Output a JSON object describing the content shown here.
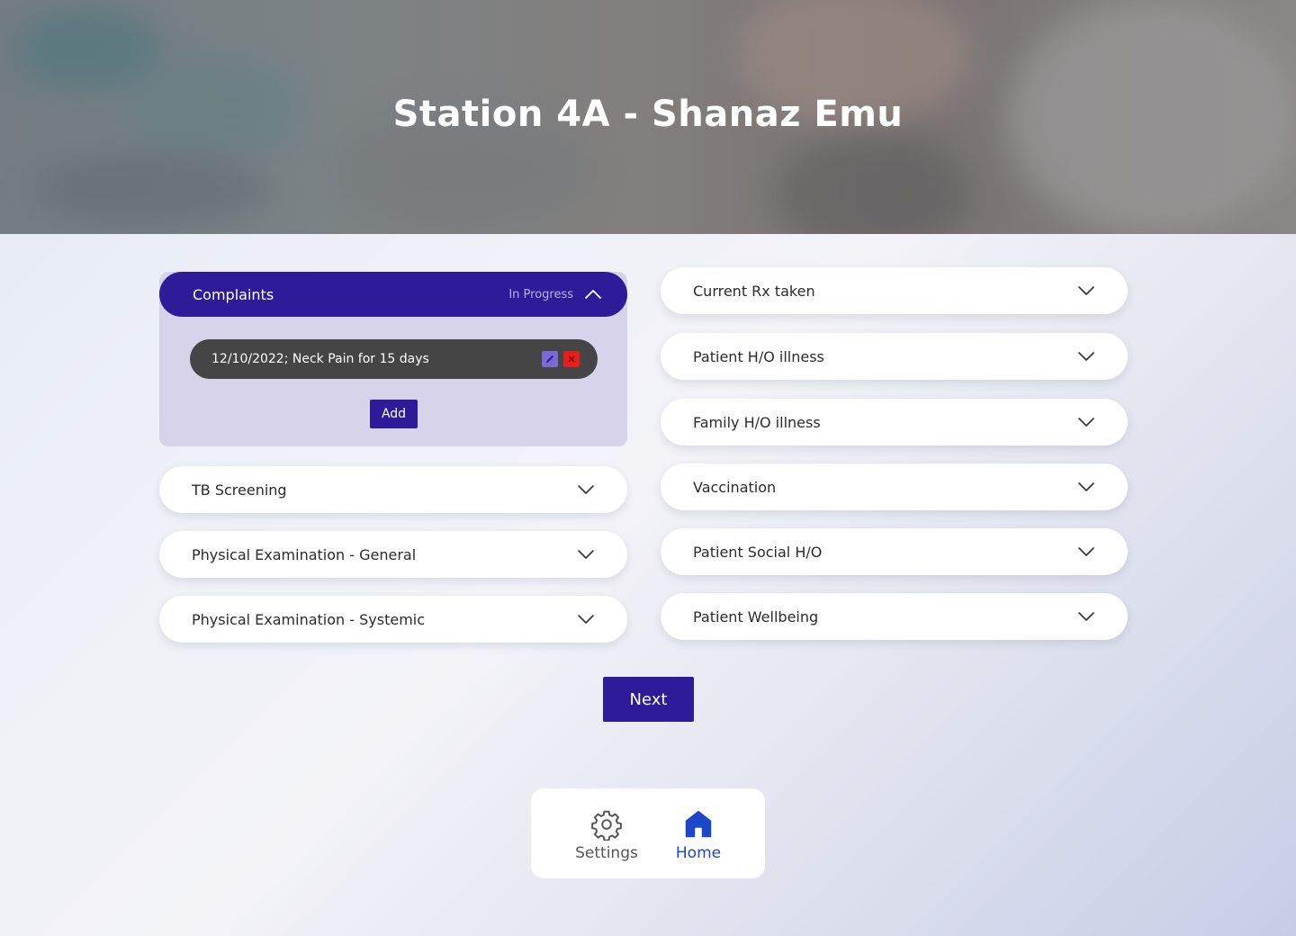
{
  "header": {
    "title": "Station 4A - Shanaz Emu"
  },
  "complaints": {
    "label": "Complaints",
    "status": "In Progress",
    "entries": [
      {
        "text": "12/10/2022; Neck Pain for 15 days"
      }
    ],
    "add_label": "Add"
  },
  "left_sections": [
    {
      "label": "TB Screening"
    },
    {
      "label": "Physical Examination - General"
    },
    {
      "label": "Physical Examination - Systemic"
    }
  ],
  "right_sections": [
    {
      "label": "Current Rx taken"
    },
    {
      "label": "Patient H/O illness"
    },
    {
      "label": "Family H/O illness"
    },
    {
      "label": "Vaccination"
    },
    {
      "label": "Patient Social H/O"
    },
    {
      "label": "Patient Wellbeing"
    }
  ],
  "next_label": "Next",
  "nav": {
    "settings_label": "Settings",
    "home_label": "Home"
  },
  "colors": {
    "primary": "#2d1b99",
    "active_panel": "#d6d3ea",
    "entry_bg": "#454545",
    "delete": "#e61e1e",
    "home_active": "#1d46c8"
  }
}
